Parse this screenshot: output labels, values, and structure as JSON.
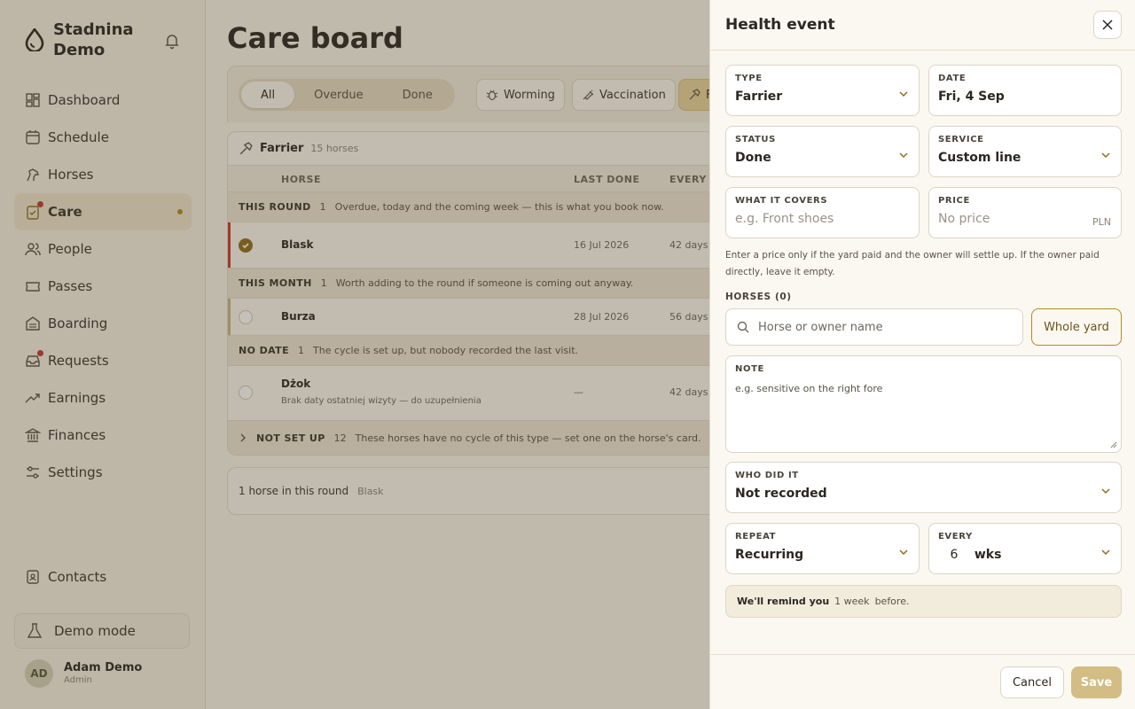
{
  "sidebar": {
    "brand": "Stadnina Demo",
    "items": [
      {
        "label": "Dashboard"
      },
      {
        "label": "Schedule"
      },
      {
        "label": "Horses"
      },
      {
        "label": "Care"
      },
      {
        "label": "People"
      },
      {
        "label": "Passes"
      },
      {
        "label": "Boarding"
      },
      {
        "label": "Requests"
      },
      {
        "label": "Earnings"
      },
      {
        "label": "Finances"
      },
      {
        "label": "Settings"
      }
    ],
    "contacts": "Contacts",
    "demo_mode": "Demo mode",
    "user": {
      "initials": "AD",
      "name": "Adam Demo",
      "role": "Admin"
    }
  },
  "main": {
    "title": "Care board",
    "segments": [
      "All",
      "Overdue",
      "Done"
    ],
    "chips": [
      "Worming",
      "Vaccination",
      "F"
    ],
    "table": {
      "title": "Farrier",
      "count": "15 horses",
      "columns": [
        "HORSE",
        "LAST DONE",
        "EVERY"
      ],
      "groups": [
        {
          "label": "THIS ROUND",
          "count": "1",
          "desc": "Overdue, today and the coming week — this is what you book now."
        },
        {
          "label": "THIS MONTH",
          "count": "1",
          "desc": "Worth adding to the round if someone is coming out anyway."
        },
        {
          "label": "NO DATE",
          "count": "1",
          "desc": "The cycle is set up, but nobody recorded the last visit."
        },
        {
          "label": "NOT SET UP",
          "count": "12",
          "desc": "These horses have no cycle of this type — set one on the horse's card."
        }
      ],
      "rows": [
        {
          "name": "Blask",
          "last": "16 Jul 2026",
          "every": "42 days"
        },
        {
          "name": "Burza",
          "last": "28 Jul 2026",
          "every": "56 days"
        },
        {
          "name": "Dżok",
          "sub": "Brak daty ostatniej wizyty — do uzupełnienia",
          "last": "—",
          "every": "42 days"
        }
      ]
    },
    "footer": {
      "text": "1 horse in this round",
      "names": "Blask"
    }
  },
  "panel": {
    "title": "Health event",
    "type": {
      "label": "TYPE",
      "value": "Farrier"
    },
    "date": {
      "label": "DATE",
      "value": "Fri, 4 Sep"
    },
    "status": {
      "label": "STATUS",
      "value": "Done"
    },
    "service": {
      "label": "SERVICE",
      "value": "Custom line"
    },
    "covers": {
      "label": "WHAT IT COVERS",
      "placeholder": "e.g. Front shoes"
    },
    "price": {
      "label": "PRICE",
      "placeholder": "No price",
      "currency": "PLN"
    },
    "help": "Enter a price only if the yard paid and the owner will settle up. If the owner paid directly, leave it empty.",
    "horses_label": "HORSES (0)",
    "search_placeholder": "Horse or owner name",
    "whole_yard": "Whole yard",
    "note": {
      "label": "NOTE",
      "placeholder": "e.g. sensitive on the right fore"
    },
    "who": {
      "label": "WHO DID IT",
      "value": "Not recorded"
    },
    "repeat": {
      "label": "REPEAT",
      "value": "Recurring"
    },
    "every": {
      "label": "EVERY",
      "value": "6",
      "unit": "wks"
    },
    "remind": {
      "prefix": "We'll remind you",
      "amount": "1 week",
      "suffix": "before."
    },
    "cancel": "Cancel",
    "save": "Save"
  },
  "colors": {
    "accent": "#b98a1d",
    "danger": "#c43a2a",
    "save": "#d3bd84"
  }
}
